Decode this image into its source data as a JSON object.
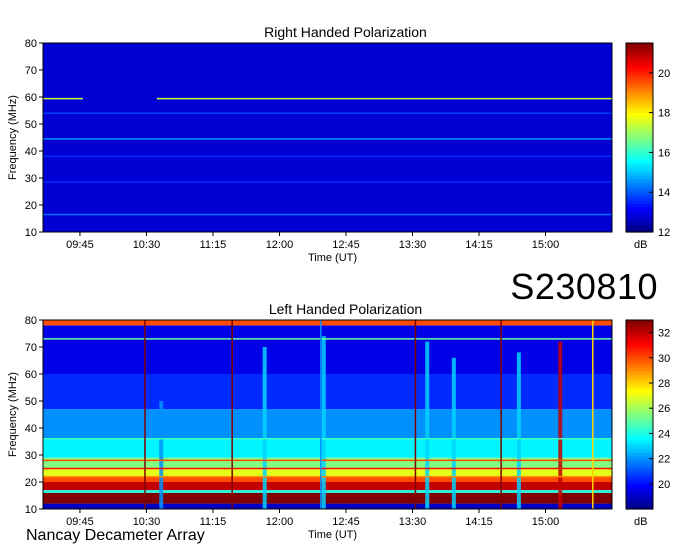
{
  "page": {
    "observation_id": "S230810",
    "observatory": "Nancay Decameter Array"
  },
  "chart_data": [
    {
      "type": "heatmap",
      "title": "Right Handed Polarization",
      "xlabel": "Time (UT)",
      "ylabel": "Frequency (MHz)",
      "xlim": [
        "09:20",
        "15:45"
      ],
      "ylim": [
        10,
        80
      ],
      "xticks": [
        "09:45",
        "10:30",
        "11:15",
        "12:00",
        "12:45",
        "13:30",
        "14:15",
        "15:00"
      ],
      "yticks": [
        10,
        20,
        30,
        40,
        50,
        60,
        70,
        80
      ],
      "colorbar": {
        "label": "dB",
        "range": [
          12,
          21.5
        ],
        "ticks": [
          12,
          14,
          16,
          18,
          20
        ]
      },
      "colormap": "jet",
      "background_level_db": 12.8,
      "horizontal_lines_mhz": [
        {
          "freq": 59.4,
          "level_db": 17.5,
          "gap": [
            "09:47",
            "10:37"
          ]
        },
        {
          "freq": 54.0,
          "level_db": 13.8
        },
        {
          "freq": 44.5,
          "level_db": 14.6
        },
        {
          "freq": 38.0,
          "level_db": 13.6
        },
        {
          "freq": 28.5,
          "level_db": 13.6
        },
        {
          "freq": 16.5,
          "level_db": 14.2
        }
      ]
    },
    {
      "type": "heatmap",
      "title": "Left Handed Polarization",
      "xlabel": "Time (UT)",
      "ylabel": "Frequency (MHz)",
      "xlim": [
        "09:20",
        "15:45"
      ],
      "ylim": [
        10,
        80
      ],
      "xticks": [
        "09:45",
        "10:30",
        "11:15",
        "12:00",
        "12:45",
        "13:30",
        "14:15",
        "15:00"
      ],
      "yticks": [
        10,
        20,
        30,
        40,
        50,
        60,
        70,
        80
      ],
      "colorbar": {
        "label": "dB",
        "range": [
          18,
          33
        ],
        "ticks": [
          20,
          22,
          24,
          26,
          28,
          30,
          32
        ]
      },
      "colormap": "jet",
      "bands_mhz": [
        {
          "from": 10,
          "to": 12,
          "level_db": 19
        },
        {
          "from": 12,
          "to": 16,
          "level_db": 33
        },
        {
          "from": 16,
          "to": 17,
          "level_db": 24
        },
        {
          "from": 17,
          "to": 20,
          "level_db": 32
        },
        {
          "from": 20,
          "to": 22,
          "level_db": 30
        },
        {
          "from": 22,
          "to": 25,
          "level_db": 27
        },
        {
          "from": 25,
          "to": 29,
          "level_db": 25.5
        },
        {
          "from": 29,
          "to": 36,
          "level_db": 23.5
        },
        {
          "from": 36,
          "to": 47,
          "level_db": 22
        },
        {
          "from": 47,
          "to": 60,
          "level_db": 20.5
        },
        {
          "from": 60,
          "to": 78,
          "level_db": 19.5
        },
        {
          "from": 78,
          "to": 80,
          "level_db": 30
        }
      ],
      "horizontal_lines_mhz": [
        {
          "freq": 73.0,
          "level_db": 25
        },
        {
          "freq": 36.0,
          "level_db": 24.5
        },
        {
          "freq": 28.0,
          "level_db": 30
        },
        {
          "freq": 25.0,
          "level_db": 31
        },
        {
          "freq": 22.0,
          "level_db": 29
        }
      ],
      "vertical_lines_utc": [
        {
          "time": "10:29",
          "level_db": 33
        },
        {
          "time": "11:28",
          "level_db": 33
        },
        {
          "time": "12:28",
          "level_db": 22
        },
        {
          "time": "13:32",
          "level_db": 33
        },
        {
          "time": "14:30",
          "level_db": 33
        },
        {
          "time": "15:32",
          "level_db": 28
        }
      ],
      "bursts_utc": [
        {
          "time": "10:40",
          "top_mhz": 50,
          "level_db": 22
        },
        {
          "time": "11:50",
          "top_mhz": 70,
          "level_db": 23
        },
        {
          "time": "12:30",
          "top_mhz": 74,
          "level_db": 23
        },
        {
          "time": "13:40",
          "top_mhz": 72,
          "level_db": 23
        },
        {
          "time": "13:58",
          "top_mhz": 66,
          "level_db": 23
        },
        {
          "time": "14:42",
          "top_mhz": 68,
          "level_db": 23
        },
        {
          "time": "15:10",
          "top_mhz": 72,
          "level_db": 32
        }
      ]
    }
  ]
}
